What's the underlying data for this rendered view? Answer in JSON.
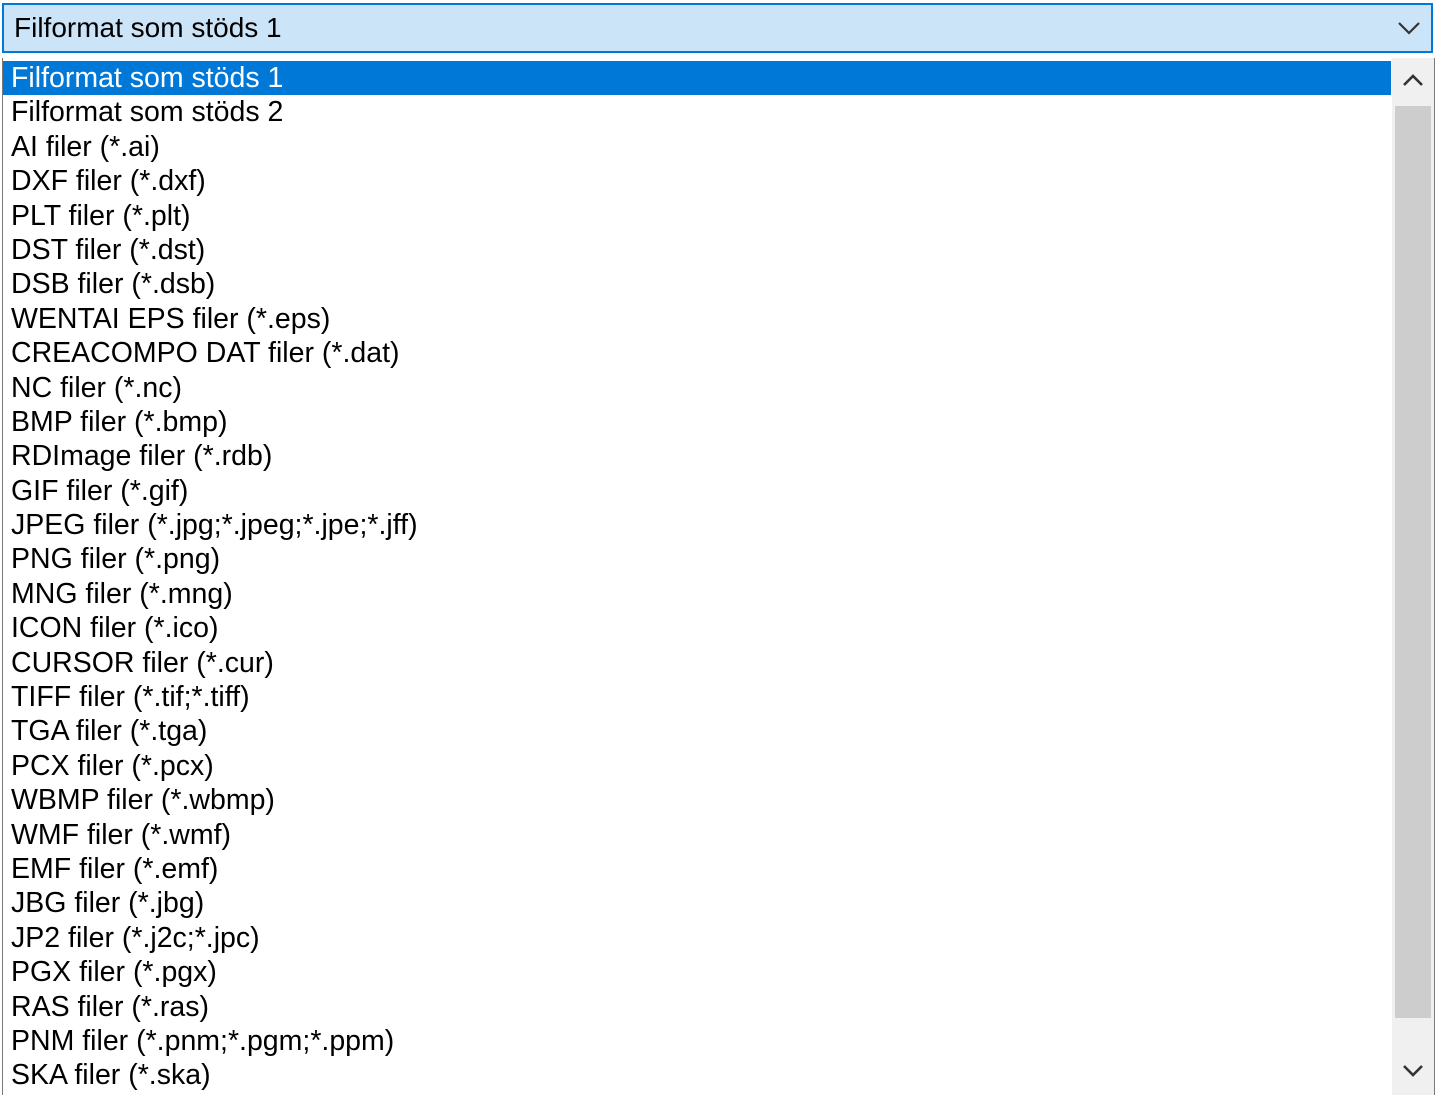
{
  "combo": {
    "selected_value": "Filformat som stöds 1",
    "arrow_icon": "chevron-down-icon"
  },
  "list": {
    "items": [
      "Filformat som stöds 1",
      "Filformat som stöds 2",
      "AI filer (*.ai)",
      "DXF filer (*.dxf)",
      "PLT filer (*.plt)",
      "DST filer (*.dst)",
      "DSB filer (*.dsb)",
      "WENTAI EPS filer (*.eps)",
      "CREACOMPO DAT filer (*.dat)",
      "NC filer (*.nc)",
      "BMP filer (*.bmp)",
      "RDImage filer (*.rdb)",
      "GIF filer (*.gif)",
      "JPEG filer (*.jpg;*.jpeg;*.jpe;*.jff)",
      "PNG filer (*.png)",
      "MNG filer (*.mng)",
      "ICON filer (*.ico)",
      "CURSOR filer (*.cur)",
      "TIFF filer (*.tif;*.tiff)",
      "TGA filer (*.tga)",
      "PCX filer (*.pcx)",
      "WBMP filer (*.wbmp)",
      "WMF filer (*.wmf)",
      "EMF filer (*.emf)",
      "JBG filer (*.jbg)",
      "JP2 filer (*.j2c;*.jpc)",
      "PGX filer (*.pgx)",
      "RAS filer (*.ras)",
      "PNM filer (*.pnm;*.pgm;*.ppm)",
      "SKA filer (*.ska)"
    ],
    "selected_index": 0
  },
  "scrollbar": {
    "up_icon": "chevron-up-icon",
    "down_icon": "chevron-down-icon"
  },
  "colors": {
    "combo_bg": "#cce4f7",
    "combo_border": "#0078d7",
    "selection_bg": "#0078d7",
    "selection_text": "#ffffff",
    "scroll_thumb": "#cdcdcd",
    "scroll_track": "#f0f0f0"
  }
}
